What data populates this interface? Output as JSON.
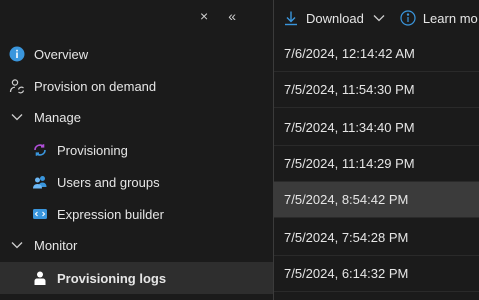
{
  "sidebar": {
    "controls": {
      "pin": "×",
      "collapse": "«"
    },
    "items": [
      {
        "label": "Overview"
      },
      {
        "label": "Provision on demand"
      },
      {
        "label": "Manage"
      },
      {
        "label": "Provisioning"
      },
      {
        "label": "Users and groups"
      },
      {
        "label": "Expression builder"
      },
      {
        "label": "Monitor"
      },
      {
        "label": "Provisioning logs"
      }
    ]
  },
  "toolbar": {
    "download_label": "Download",
    "learn_more_label": "Learn mo"
  },
  "logs": {
    "rows": [
      {
        "date": "7/6/2024, 12:14:42 AM"
      },
      {
        "date": "7/5/2024, 11:54:30 PM"
      },
      {
        "date": "7/5/2024, 11:34:40 PM"
      },
      {
        "date": "7/5/2024, 11:14:29 PM"
      },
      {
        "date": "7/5/2024, 8:54:42 PM"
      },
      {
        "date": "7/5/2024, 7:54:28 PM"
      },
      {
        "date": "7/5/2024, 6:14:32 PM"
      }
    ],
    "selected_index": 4
  },
  "colors": {
    "accent": "#3a96dd",
    "background": "#1b1b1b",
    "selected_row": "#3b3b3b"
  }
}
